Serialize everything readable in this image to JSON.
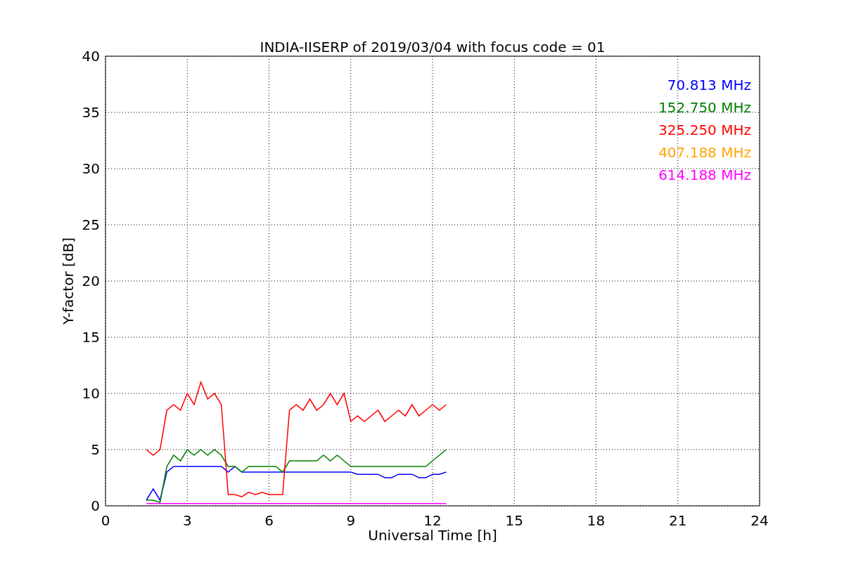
{
  "chart_data": {
    "type": "line",
    "title": "INDIA-IISERP of 2019/03/04 with focus code = 01",
    "xlabel": "Universal Time [h]",
    "ylabel": "Y-factor [dB]",
    "xlim": [
      0,
      24
    ],
    "ylim": [
      0,
      40
    ],
    "xticks": [
      0,
      3,
      6,
      9,
      12,
      15,
      18,
      21,
      24
    ],
    "yticks": [
      0,
      5,
      10,
      15,
      20,
      25,
      30,
      35,
      40
    ],
    "grid": true,
    "x": [
      1.5,
      1.75,
      2.0,
      2.25,
      2.5,
      2.75,
      3.0,
      3.25,
      3.5,
      3.75,
      4.0,
      4.25,
      4.5,
      4.75,
      5.0,
      5.25,
      5.5,
      5.75,
      6.0,
      6.25,
      6.5,
      6.75,
      7.0,
      7.25,
      7.5,
      7.75,
      8.0,
      8.25,
      8.5,
      8.75,
      9.0,
      9.25,
      9.5,
      9.75,
      10.0,
      10.25,
      10.5,
      10.75,
      11.0,
      11.25,
      11.5,
      11.75,
      12.0,
      12.25,
      12.5
    ],
    "series": [
      {
        "name": "70.813 MHz",
        "color": "#0000ff",
        "values": [
          0.5,
          1.5,
          0.5,
          3,
          3.5,
          3.5,
          3.5,
          3.5,
          3.5,
          3.5,
          3.5,
          3.5,
          3,
          3.5,
          3,
          3,
          3,
          3,
          3,
          3,
          3,
          3,
          3,
          3,
          3,
          3,
          3,
          3,
          3,
          3,
          3,
          2.8,
          2.8,
          2.8,
          2.8,
          2.5,
          2.5,
          2.8,
          2.8,
          2.8,
          2.5,
          2.5,
          2.8,
          2.8,
          3
        ]
      },
      {
        "name": "152.750 MHz",
        "color": "#008000",
        "values": [
          0.5,
          0.5,
          0.3,
          3.5,
          4.5,
          4,
          5,
          4.5,
          5,
          4.5,
          5,
          4.5,
          3.5,
          3.5,
          3,
          3.5,
          3.5,
          3.5,
          3.5,
          3.5,
          3,
          4,
          4,
          4,
          4,
          4,
          4.5,
          4,
          4.5,
          4,
          3.5,
          3.5,
          3.5,
          3.5,
          3.5,
          3.5,
          3.5,
          3.5,
          3.5,
          3.5,
          3.5,
          3.5,
          4,
          4.5,
          5
        ]
      },
      {
        "name": "325.250 MHz",
        "color": "#ff0000",
        "values": [
          5,
          4.5,
          5,
          8.5,
          9,
          8.5,
          10,
          9,
          11,
          9.5,
          10,
          9,
          1,
          1,
          0.8,
          1.2,
          1,
          1.2,
          1,
          1,
          1,
          8.5,
          9,
          8.5,
          9.5,
          8.5,
          9,
          10,
          9,
          10,
          7.5,
          8,
          7.5,
          8,
          8.5,
          7.5,
          8,
          8.5,
          8,
          9,
          8,
          8.5,
          9,
          8.5,
          9
        ]
      },
      {
        "name": "407.188 MHz",
        "color": "#ffa500",
        "values": [
          null,
          null,
          null,
          null,
          null,
          null,
          null,
          null,
          null,
          null,
          null,
          null,
          null,
          null,
          null,
          null,
          null,
          null,
          null,
          null,
          null,
          null,
          null,
          null,
          null,
          null,
          null,
          null,
          null,
          null,
          null,
          null,
          null,
          null,
          null,
          null,
          null,
          null,
          null,
          null,
          null,
          null,
          null,
          null,
          null
        ]
      },
      {
        "name": "614.188 MHz",
        "color": "#ff00ff",
        "values": [
          0.2,
          0.2,
          0.2,
          0.2,
          0.2,
          0.2,
          0.2,
          0.2,
          0.2,
          0.2,
          0.2,
          0.2,
          0.2,
          0.2,
          0.2,
          0.2,
          0.2,
          0.2,
          0.2,
          0.2,
          0.2,
          0.2,
          0.2,
          0.2,
          0.2,
          0.2,
          0.2,
          0.2,
          0.2,
          0.2,
          0.2,
          0.2,
          0.2,
          0.2,
          0.2,
          0.2,
          0.2,
          0.2,
          0.2,
          0.2,
          0.2,
          0.2,
          0.2,
          0.2,
          0.2
        ]
      }
    ]
  }
}
